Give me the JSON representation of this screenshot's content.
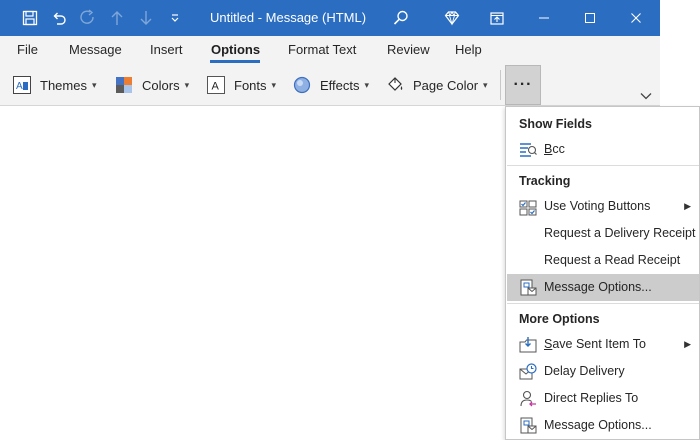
{
  "window": {
    "title": "Untitled  -  Message (HTML)"
  },
  "quick_access": {
    "icons": [
      "save-icon",
      "undo-icon",
      "redo-icon",
      "up-arrow-icon",
      "down-arrow-icon",
      "customize-icon"
    ]
  },
  "titlebar_icons": [
    "search-icon",
    "diamond-icon",
    "restore-window-icon"
  ],
  "tabs": [
    {
      "label": "File"
    },
    {
      "label": "Message"
    },
    {
      "label": "Insert"
    },
    {
      "label": "Options",
      "active": true
    },
    {
      "label": "Format Text"
    },
    {
      "label": "Review"
    },
    {
      "label": "Help"
    }
  ],
  "ribbon": {
    "themes": "Themes",
    "colors": "Colors",
    "fonts": "Fonts",
    "effects": "Effects",
    "page_color": "Page Color",
    "more": "···"
  },
  "menu": {
    "show_fields_header": "Show Fields",
    "bcc_prefix": "B",
    "bcc_rest": "cc",
    "tracking_header": "Tracking",
    "voting": "Use Voting Buttons",
    "delivery_receipt": "Request a Delivery Receipt",
    "read_receipt": "Request a Read Receipt",
    "message_options_hl": "Message Options...",
    "more_options_header": "More Options",
    "save_sent_prefix": "S",
    "save_sent_rest": "ave Sent Item To",
    "delay_delivery": "Delay Delivery",
    "direct_replies": "Direct Replies To",
    "message_options": "Message Options..."
  },
  "colors": {
    "title_bar": "#2b6dc0",
    "ribbon_bg": "#f3f3f3",
    "highlight": "#cccccc"
  }
}
